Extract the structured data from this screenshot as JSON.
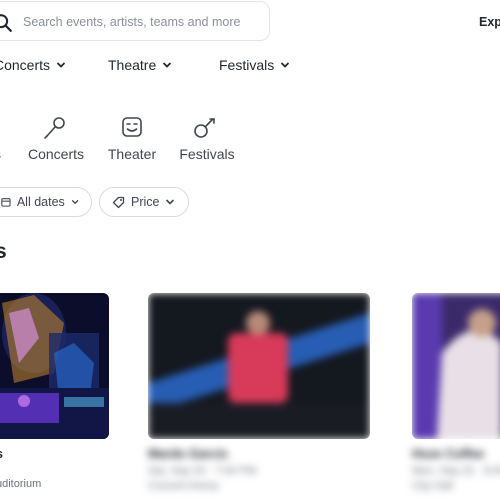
{
  "search": {
    "placeholder": "Search events, artists, teams and more"
  },
  "header": {
    "explore_label": "Exp"
  },
  "nav": {
    "items": [
      {
        "label": "Concerts"
      },
      {
        "label": "Theatre"
      },
      {
        "label": "Festivals"
      }
    ]
  },
  "categories": {
    "items": [
      {
        "label": "s",
        "icon": "partial-icon"
      },
      {
        "label": "Concerts",
        "icon": "microphone-icon"
      },
      {
        "label": "Theater",
        "icon": "theater-mask-icon"
      },
      {
        "label": "Festivals",
        "icon": "festival-icon"
      }
    ]
  },
  "filters": {
    "dates_label": "All dates",
    "price_label": "Price"
  },
  "section": {
    "title": "ts"
  },
  "events": [
    {
      "title": "s",
      "venue": "uditorium"
    },
    {
      "title": "Mardo Garcis",
      "date": "Sat, Sep 20 · 7:00 PM",
      "venue": "Concert Arena"
    },
    {
      "title": "Hoze Coffee",
      "date": "Mon, Sep 22 · 8:00 PM",
      "venue": "City Hall"
    }
  ],
  "colors": {
    "text": "#1f262d",
    "muted": "#6b7079",
    "border": "#d8dadf"
  }
}
